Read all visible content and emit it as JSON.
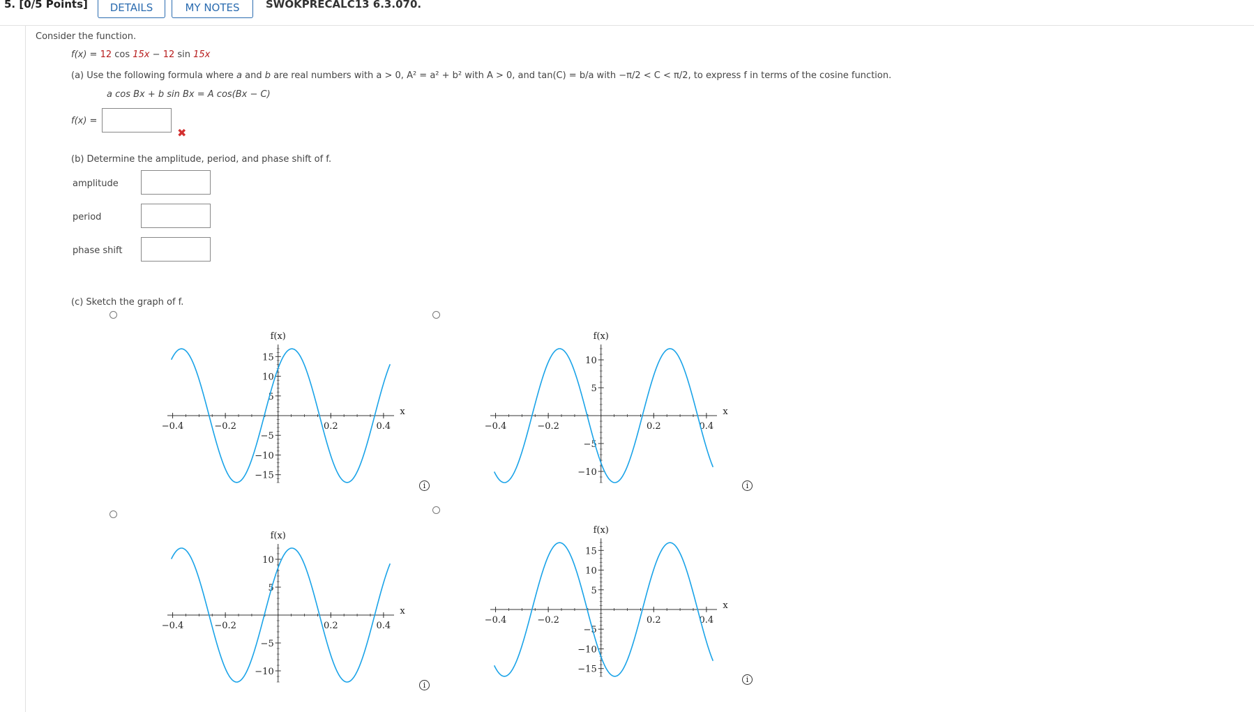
{
  "header": {
    "question_number": "5. [0/5 Points]",
    "details_label": "DETAILS",
    "notes_label": "MY NOTES",
    "code": "SWOKPRECALC13 6.3.070."
  },
  "question": {
    "intro": "Consider the function.",
    "fx_prefix": "f(x) = ",
    "coef1": "12",
    "cos_text": " cos ",
    "arg1": "15x",
    "minus": " − ",
    "coef2": "12",
    "sin_text": " sin ",
    "arg2": "15x",
    "part_a_prefix": "(a) Use the following formula where ",
    "part_a_a": "a",
    "part_a_mid1": " and ",
    "part_a_b": "b",
    "part_a_rest": " are real numbers with a > 0, A² = a² + b² with A > 0, and tan(C) = b/a with −π/2 < C < π/2, to express f in terms of the cosine function.",
    "formula": "a cos Bx + b sin Bx = A cos(Bx − C)",
    "fx_answer_label": "f(x) =",
    "fx_answer_value": "",
    "wrong_mark": "✖",
    "part_b": "(b) Determine the amplitude, period, and phase shift of f.",
    "amplitude_label": "amplitude",
    "amplitude_value": "",
    "period_label": "period",
    "period_value": "",
    "phase_label": "phase shift",
    "phase_value": "",
    "part_c": "(c) Sketch the graph of f."
  },
  "icons": {
    "info": "info-icon",
    "radio": "radio-button"
  },
  "colors": {
    "curve": "#1aa3e8",
    "accent": "#2b6cb0",
    "wrong": "#d33030"
  },
  "chart_data": [
    {
      "type": "line",
      "id": "graph-a",
      "xlabel": "x",
      "ylabel": "f(x)",
      "xlim": [
        -0.42,
        0.44
      ],
      "ylim": [
        -17,
        17
      ],
      "function": {
        "amplitude": 16.97,
        "B": 15,
        "shift": 0.0524,
        "reflect": false
      },
      "xticks": [
        -0.4,
        -0.2,
        0.2,
        0.4
      ],
      "xtick_labels": [
        "−0.4",
        "−0.2",
        "0.2",
        "0.4"
      ],
      "yticks": [
        15,
        10,
        5,
        -5,
        -10,
        -15
      ],
      "ytick_labels": [
        "15",
        "10",
        "5",
        "−5",
        "−10",
        "−15"
      ]
    },
    {
      "type": "line",
      "id": "graph-b",
      "xlabel": "x",
      "ylabel": "f(x)",
      "xlim": [
        -0.42,
        0.44
      ],
      "ylim": [
        -12,
        12
      ],
      "function": {
        "amplitude": 12,
        "B": 15,
        "shift": 0.0524,
        "reflect": true
      },
      "xticks": [
        -0.4,
        -0.2,
        0.2,
        0.4
      ],
      "xtick_labels": [
        "−0.4",
        "−0.2",
        "0.2",
        "0.4"
      ],
      "yticks": [
        10,
        5,
        -5,
        -10
      ],
      "ytick_labels": [
        "10",
        "5",
        "−5",
        "−10"
      ]
    },
    {
      "type": "line",
      "id": "graph-c",
      "xlabel": "x",
      "ylabel": "f(x)",
      "xlim": [
        -0.42,
        0.44
      ],
      "ylim": [
        -12,
        12
      ],
      "function": {
        "amplitude": 12,
        "B": 15,
        "shift": 0.0524,
        "reflect": false
      },
      "xticks": [
        -0.4,
        -0.2,
        0.2,
        0.4
      ],
      "xtick_labels": [
        "−0.4",
        "−0.2",
        "0.2",
        "0.4"
      ],
      "yticks": [
        10,
        5,
        -5,
        -10
      ],
      "ytick_labels": [
        "10",
        "5",
        "−5",
        "−10"
      ]
    },
    {
      "type": "line",
      "id": "graph-d",
      "xlabel": "x",
      "ylabel": "f(x)",
      "xlim": [
        -0.42,
        0.44
      ],
      "ylim": [
        -17,
        17
      ],
      "function": {
        "amplitude": 16.97,
        "B": 15,
        "shift": 0.0524,
        "reflect": true
      },
      "xticks": [
        -0.4,
        -0.2,
        0.2,
        0.4
      ],
      "xtick_labels": [
        "−0.4",
        "−0.2",
        "0.2",
        "0.4"
      ],
      "yticks": [
        15,
        10,
        5,
        -5,
        -10,
        -15
      ],
      "ytick_labels": [
        "15",
        "10",
        "5",
        "−5",
        "−10",
        "−15"
      ]
    }
  ]
}
